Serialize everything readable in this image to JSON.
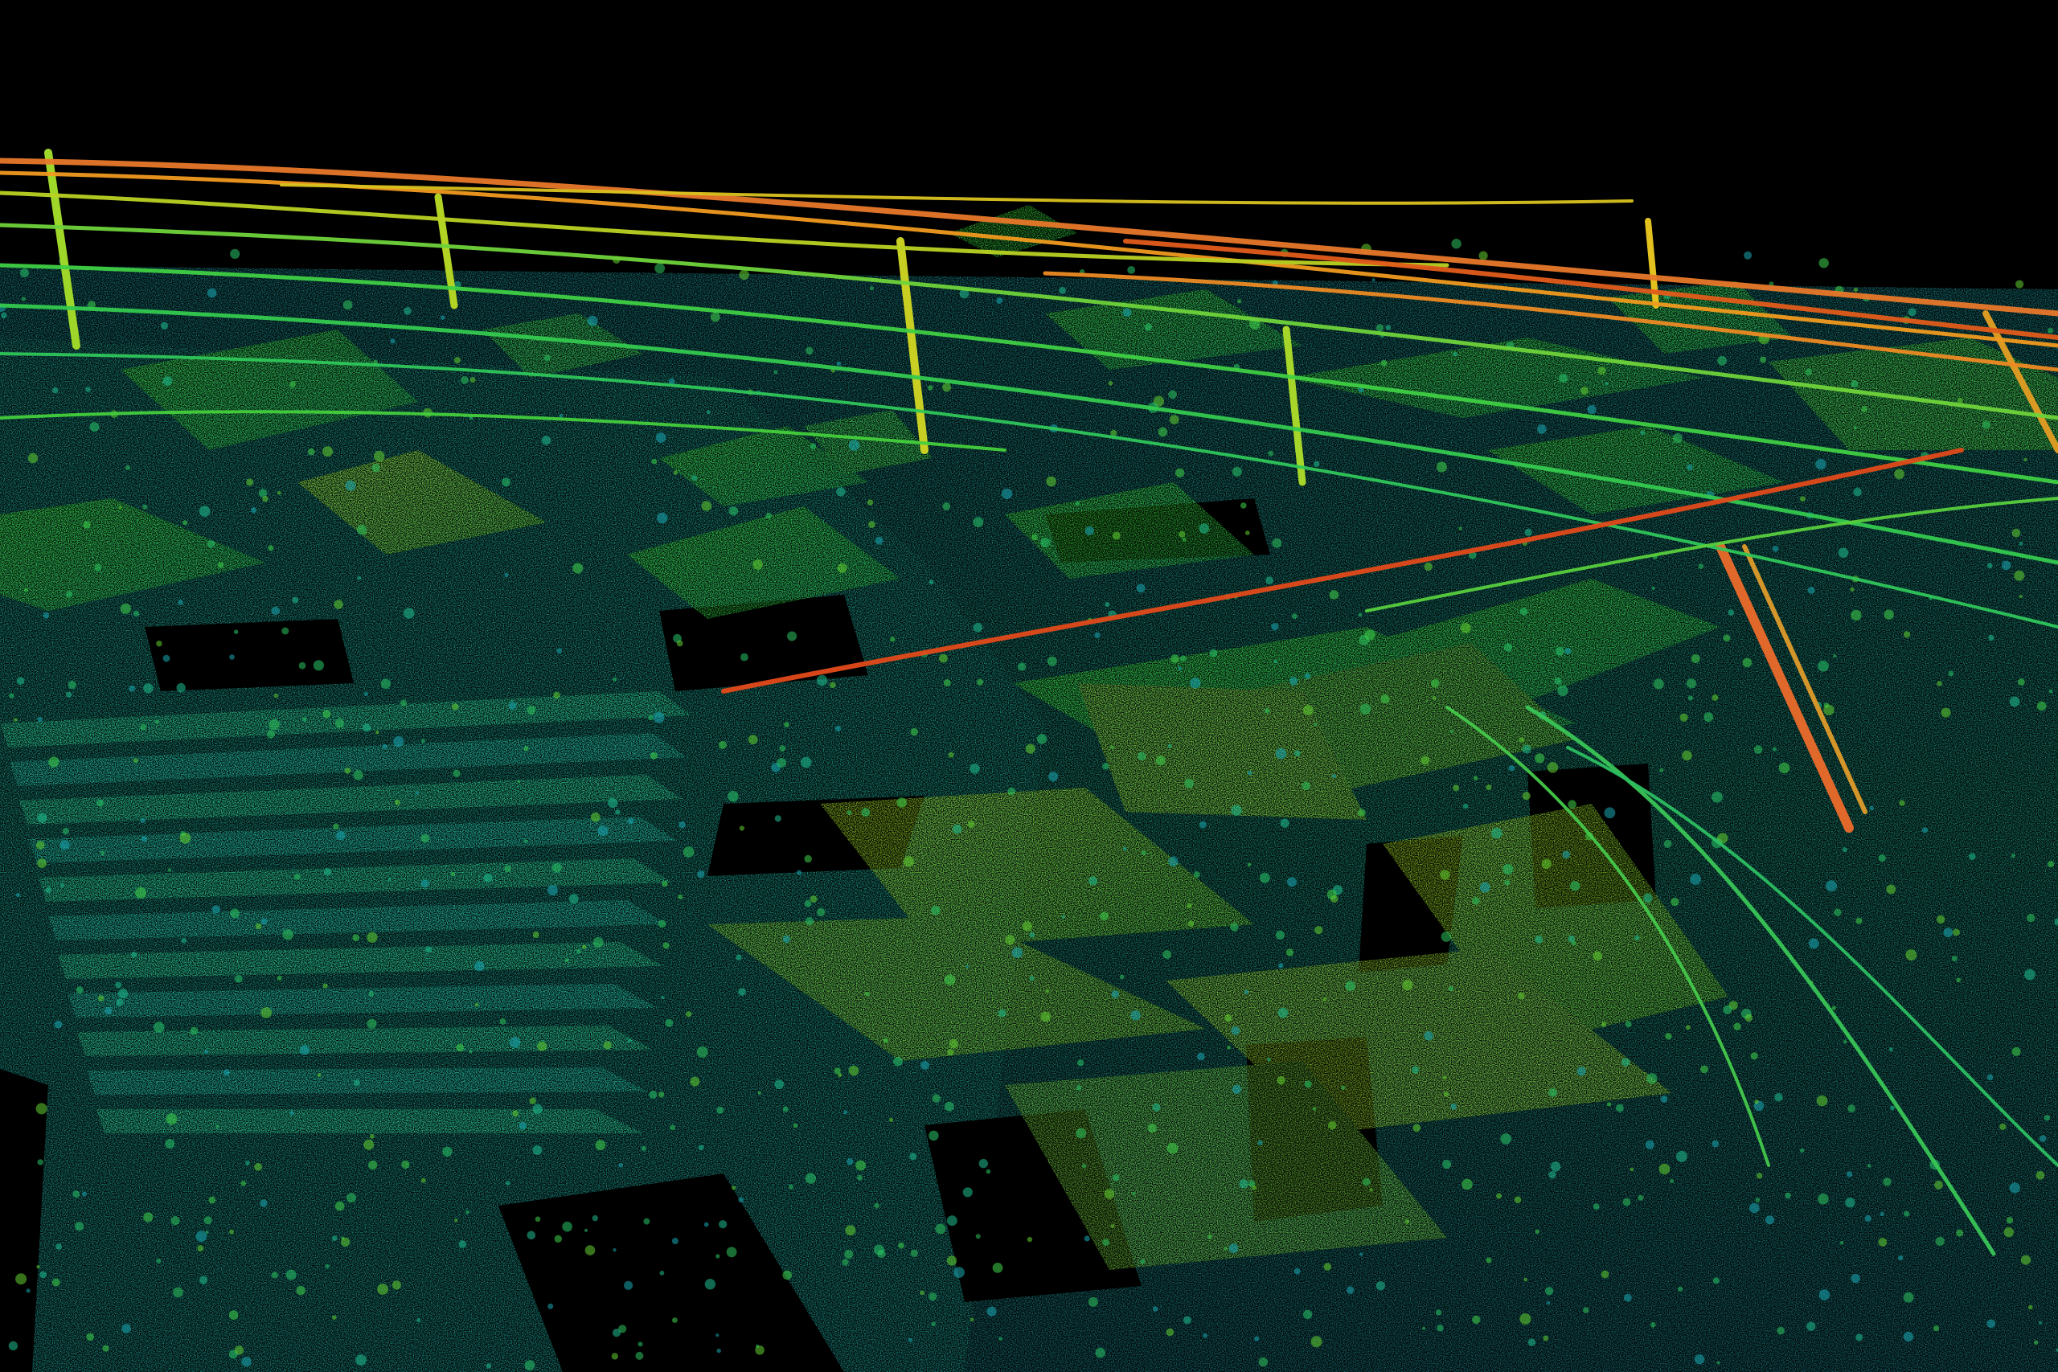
{
  "scene": {
    "icon": "lidar-point-cloud-icon",
    "background_color": "#000000",
    "elevation_colors": [
      "#1aa9b5",
      "#22c46a",
      "#44d91f",
      "#9fe51a",
      "#e3d41a",
      "#f08a1a",
      "#e8461a"
    ]
  }
}
